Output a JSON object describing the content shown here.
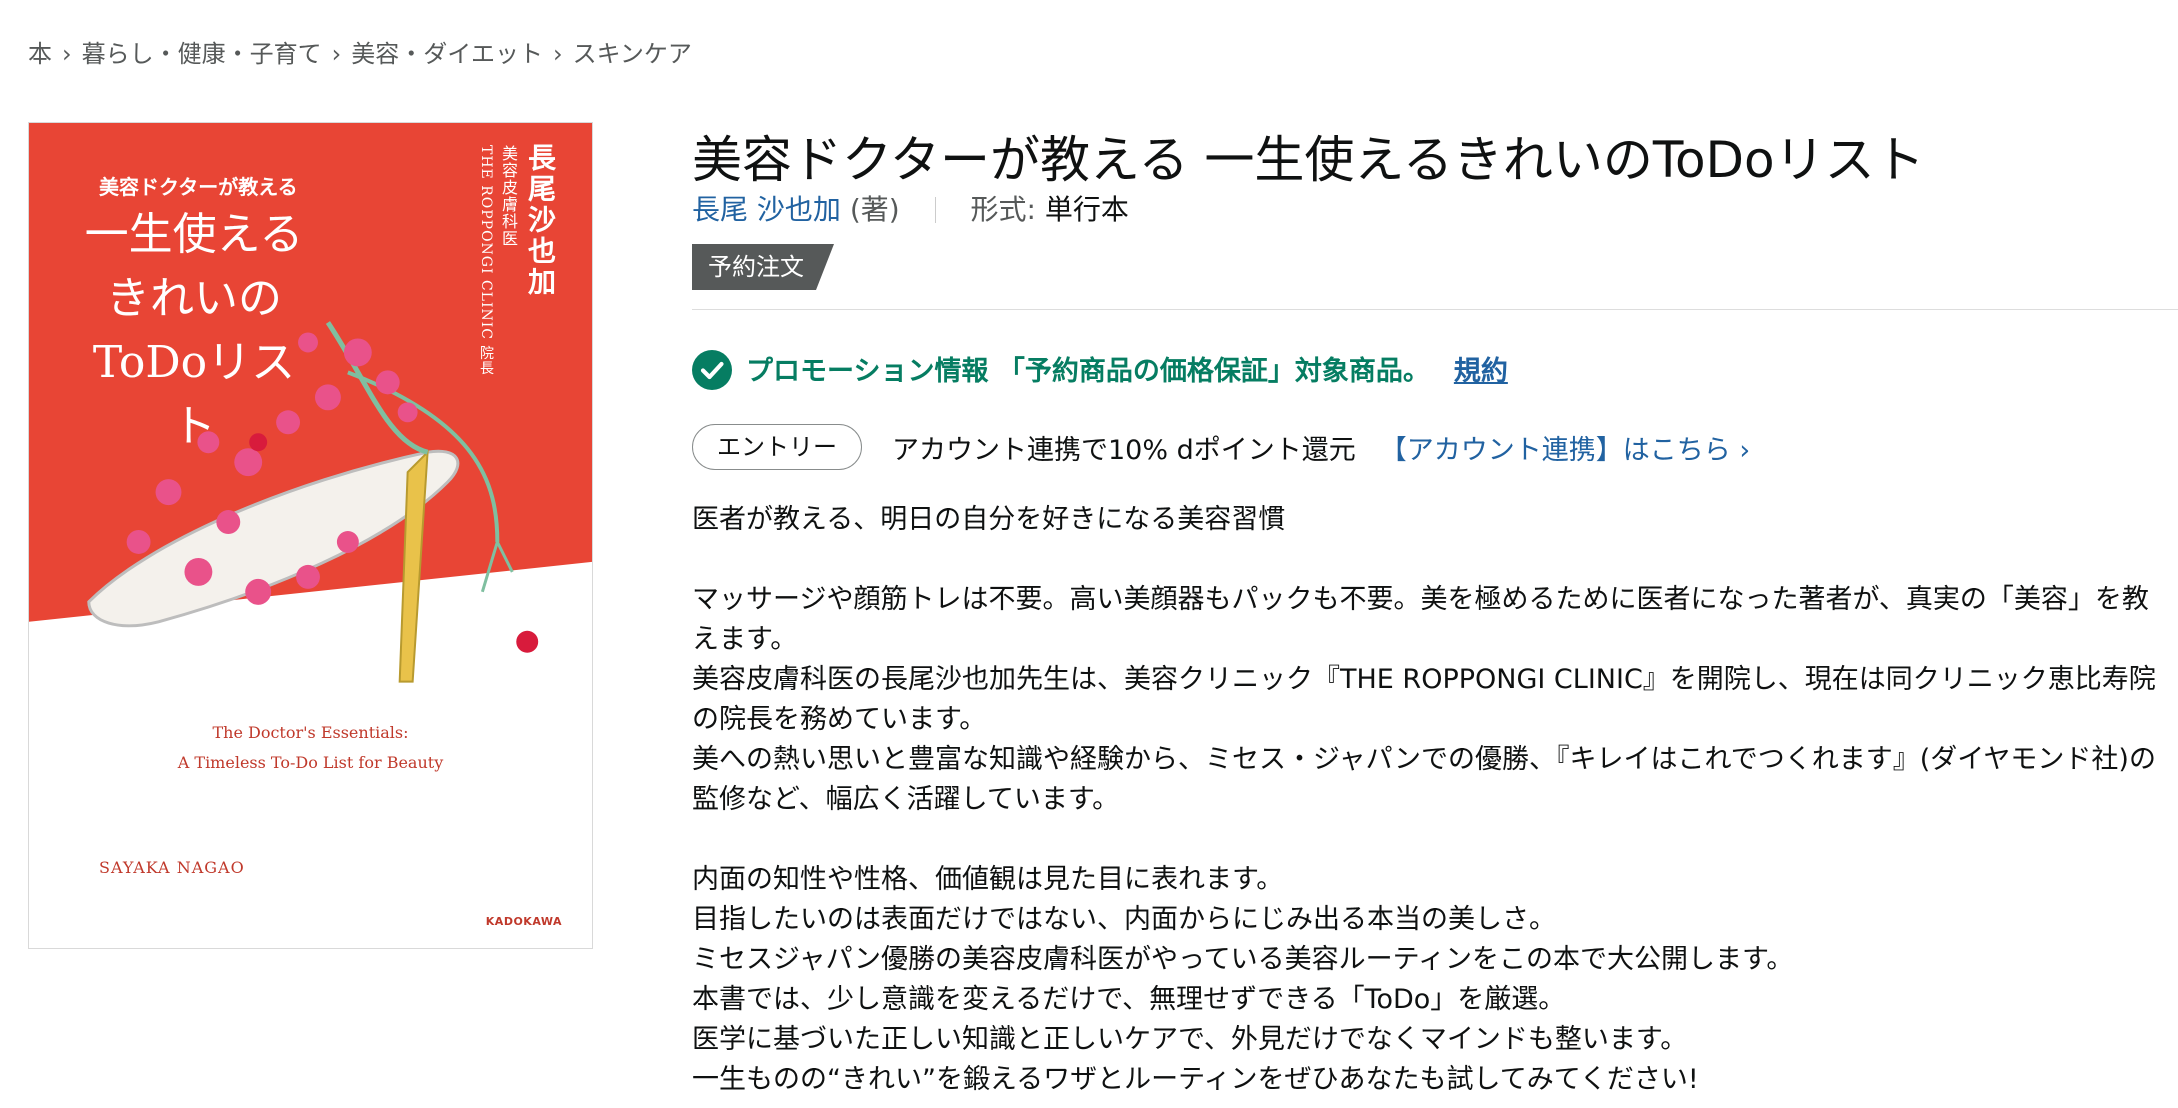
{
  "breadcrumb": [
    "本",
    "暮らし・健康・子育て",
    "美容・ダイエット",
    "スキンケア"
  ],
  "breadcrumb_separator": "›",
  "cover": {
    "small_title": "美容ドクターが教える",
    "big_title_line1": "一生使える",
    "big_title_line2": "きれいの",
    "big_title_line3": "ToDoリスト",
    "author_vertical": "長尾沙也加",
    "role_vertical": "美容皮膚科医",
    "clinic_vertical": "THE ROPPONGI CLINIC 院長",
    "english_title_line1": "The Doctor's Essentials:",
    "english_title_line2": "A Timeless To-Do List for Beauty",
    "english_author": "SAYAKA NAGAO",
    "publisher": "KADOKAWA",
    "background_color": "#e84535"
  },
  "product": {
    "title": "美容ドクターが教える 一生使えるきれいのToDoリスト",
    "author": "長尾 沙也加",
    "author_role": "(著)",
    "format_label": "形式:",
    "format_value": "単行本",
    "badge": "予約注文"
  },
  "promotion": {
    "icon": "check-circle-icon",
    "text": "プロモーション情報 「予約商品の価格保証」対象商品。",
    "terms_link": "規約",
    "color": "#067d62"
  },
  "entry": {
    "button_label": "エントリー",
    "text": "アカウント連携で10% dポイント還元",
    "link": "【アカウント連携】はこちら ›"
  },
  "description": [
    "医者が教える、明日の自分を好きになる美容習慣",
    "",
    "マッサージや顔筋トレは不要。高い美顔器もパックも不要。美を極めるために医者になった著者が、真実の「美容」を教えます。",
    "美容皮膚科医の長尾沙也加先生は、美容クリニック『THE ROPPONGI CLINIC』を開院し、現在は同クリニック恵比寿院の院長を務めています。",
    "美への熱い思いと豊富な知識や経験から、ミセス・ジャパンでの優勝、『キレイはこれでつくれます』(ダイヤモンド社)の監修など、幅広く活躍しています。",
    "",
    "内面の知性や性格、価値観は見た目に表れます。",
    "目指したいのは表面だけではない、内面からにじみ出る本当の美しさ。",
    "ミセスジャパン優勝の美容皮膚科医がやっている美容ルーティンをこの本で大公開します。",
    "本書では、少し意識を変えるだけで、無理せずできる「ToDo」を厳選。",
    "医学に基づいた正しい知識と正しいケアで、外見だけでなくマインドも整います。",
    "一生ものの“きれい”を鍛えるワザとルーティンをぜひあなたも試してみてください!"
  ]
}
